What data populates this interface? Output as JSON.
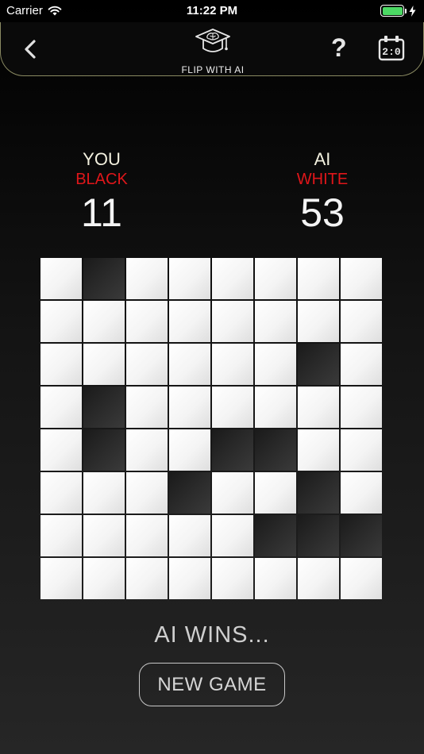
{
  "status_bar": {
    "carrier": "Carrier",
    "time": "11:22 PM",
    "battery_color": "#4cd964"
  },
  "nav": {
    "title": "FLIP WITH AI",
    "help_label": "?",
    "icons": {
      "back": "chevron-left-icon",
      "logo": "graduation-cap-brain-icon",
      "scoreboard": "scoreboard-icon"
    },
    "border_color": "#8a8a62"
  },
  "players": {
    "you": {
      "name": "YOU",
      "color": "BLACK",
      "score": "11"
    },
    "ai": {
      "name": "AI",
      "color": "WHITE",
      "score": "53"
    }
  },
  "board": {
    "rows": [
      "WBWWWWWW",
      "WWWWWWWW",
      "WWWWWWBW",
      "WBWWWWWW",
      "WBWWBBWW",
      "WWWBWWBW",
      "WWWWWBBB",
      "WWWWWWWW"
    ]
  },
  "result_text": "AI WINS...",
  "new_game_label": "NEW GAME",
  "accent_color": "#e0161a"
}
